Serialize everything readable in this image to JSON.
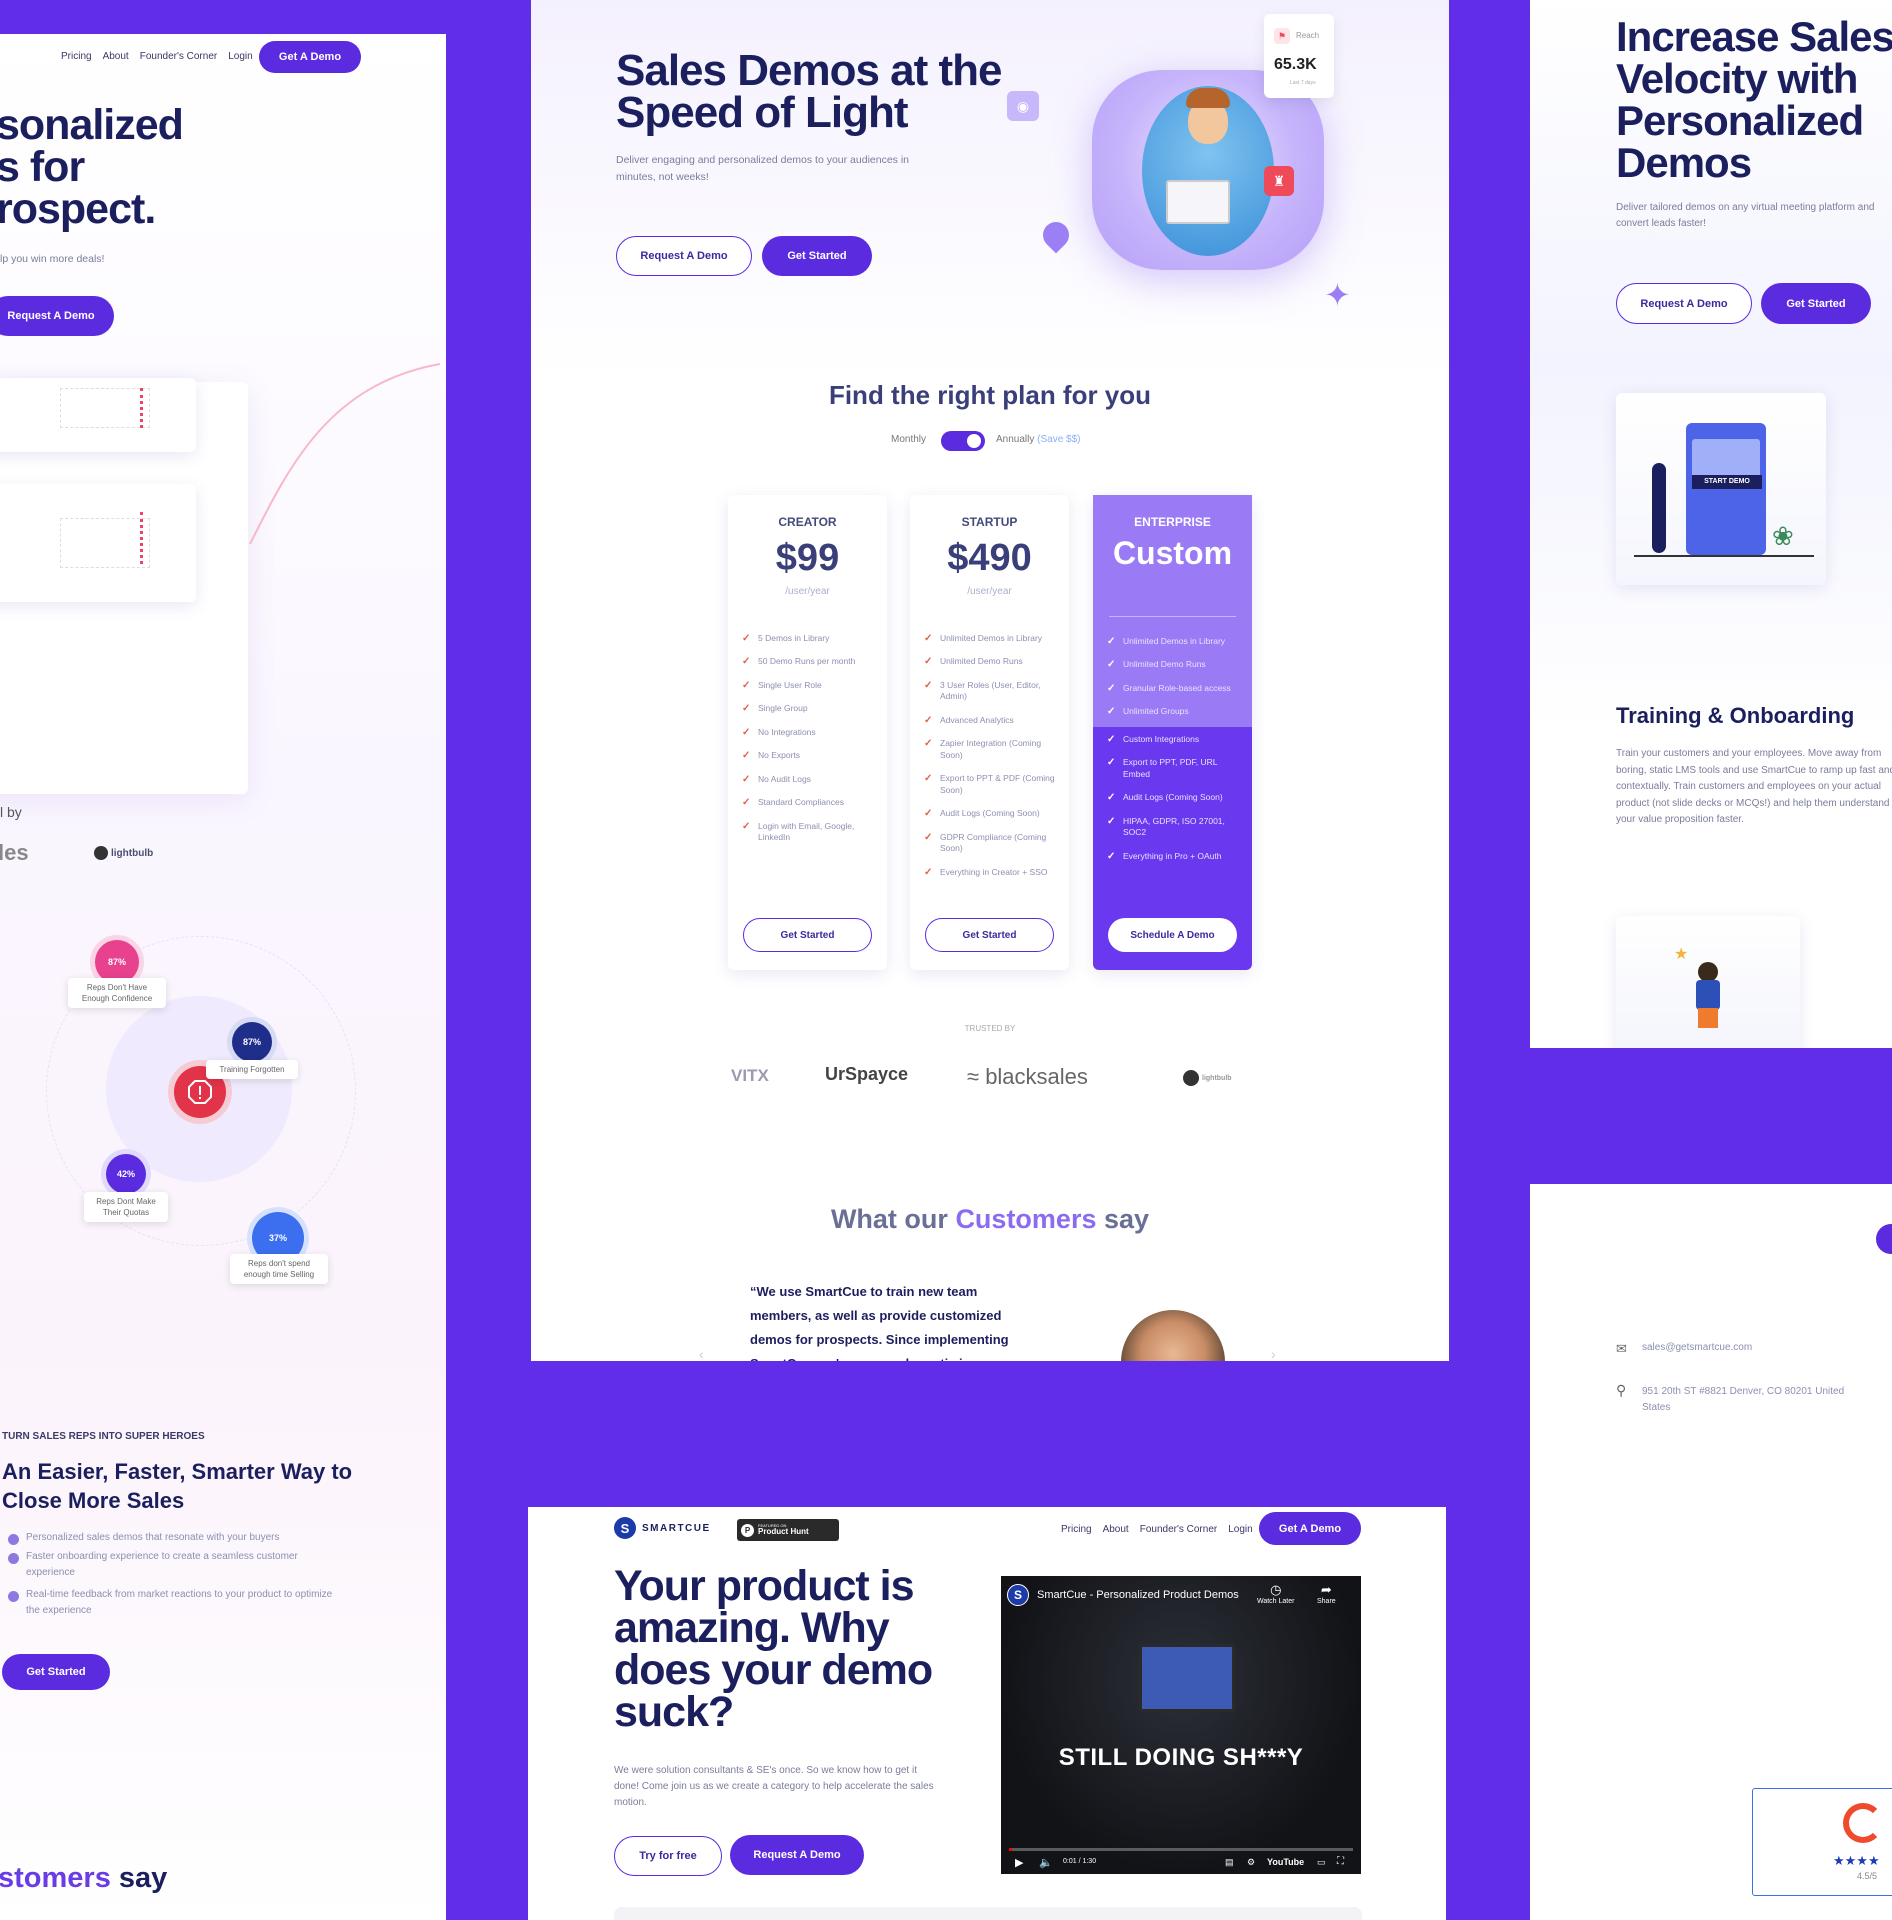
{
  "colors": {
    "brand": "#5b2be0",
    "background": "#612de8",
    "accent": "#8b6cf0",
    "check": "#e0614a",
    "pink": "#e8418e",
    "navy": "#1c1f5e"
  },
  "left": {
    "nav": [
      "Pricing",
      "About",
      "Founder's Corner",
      "Login"
    ],
    "nav_cta": "Get A Demo",
    "hero_lines": [
      "sonalized",
      "s for",
      "rospect."
    ],
    "hero_sub": "lp you win more deals!",
    "hero_cta": "Request A Demo",
    "trusted_label": "l by",
    "logos": [
      "les",
      "lightbulb"
    ],
    "stats": [
      {
        "value": "87%",
        "label": "Reps Don't Have Enough Confidence",
        "color": "#e8418e"
      },
      {
        "value": "87%",
        "label": "Training Forgotten",
        "color": "#1e2e8a"
      },
      {
        "value": "42%",
        "label": "Reps Dont Make Their Quotas",
        "color": "#5b2be0"
      },
      {
        "value": "37%",
        "label": "Reps don't spend enough time Selling",
        "color": "#3b6ff0"
      }
    ],
    "center_icon": "alert-icon",
    "eyebrow": "TURN SALES REPS INTO SUPER HEROES",
    "section_title": "An Easier, Faster, Smarter Way to Close More Sales",
    "bullets": [
      "Personalized sales demos that resonate with your buyers",
      "Faster onboarding experience to create a seamless customer experience",
      "Real-time feedback from market reactions to your product to optimize the experience"
    ],
    "cta": "Get Started",
    "bottom_title_a": "stomers",
    "bottom_title_b": "say"
  },
  "center": {
    "hero_title": "Sales Demos at the Speed of Light",
    "hero_sub": "Deliver engaging and personalized demos to your audiences in minutes, not weeks!",
    "btn_demo": "Request A Demo",
    "btn_start": "Get Started",
    "reach_label": "Reach",
    "reach_value": "65.3K",
    "reach_period": "Last 7 days",
    "pricing_title": "Find the right plan for you",
    "toggle_monthly": "Monthly",
    "toggle_annually": "Annually",
    "toggle_save": "(Save $$)",
    "plans": [
      {
        "name": "CREATOR",
        "price": "$99",
        "per": "/user/year",
        "cta": "Get Started",
        "features": [
          "5 Demos in Library",
          "50 Demo Runs per month",
          "Single User Role",
          "Single Group",
          "No Integrations",
          "No Exports",
          "No Audit Logs",
          "Standard Compliances",
          "Login with Email, Google, LinkedIn"
        ]
      },
      {
        "name": "STARTUP",
        "price": "$490",
        "per": "/user/year",
        "cta": "Get Started",
        "features": [
          "Unlimited Demos in Library",
          "Unlimited Demo Runs",
          "3 User Roles (User, Editor, Admin)",
          "Advanced Analytics",
          "Zapier Integration (Coming Soon)",
          "Export to PPT & PDF (Coming Soon)",
          "Audit Logs (Coming Soon)",
          "GDPR Compliance (Coming Soon)",
          "Everything in Creator + SSO"
        ]
      },
      {
        "name": "ENTERPRISE",
        "price": "Custom",
        "per": "",
        "cta": "Schedule A Demo",
        "features": [
          "Unlimited Demos in Library",
          "Unlimited Demo Runs",
          "Granular Role-based access",
          "Unlimited Groups",
          "Custom Integrations",
          "Export to PPT, PDF, URL Embed",
          "Audit Logs (Coming Soon)",
          "HIPAA, GDPR, ISO 27001, SOC2",
          "Everything in Pro + OAuth"
        ]
      }
    ],
    "trusted_by": "TRUSTED BY",
    "logos": [
      "VITX",
      "UrSpayce",
      "blacksales",
      "lightbulb"
    ],
    "testimonial_title_a": "What our",
    "testimonial_title_b": "Customers",
    "testimonial_title_c": "say",
    "quote": "“We use SmartCue to train new team members, as well as provide customized demos for prospects. Since implementing SmartCue, we've seen a dramatic increase in"
  },
  "bottom": {
    "brand": "SMARTCUE",
    "ph_small": "FEATURED ON",
    "ph_label": "Product Hunt",
    "nav": [
      "Pricing",
      "About",
      "Founder's Corner",
      "Login"
    ],
    "nav_cta": "Get A Demo",
    "title": "Your product is amazing. Why does your demo suck?",
    "sub": "We were solution consultants & SE's once. So we know how to get it done! Come join us as we create a category to help accelerate the sales motion.",
    "btn_try": "Try for free",
    "btn_demo": "Request A Demo",
    "video_title": "SmartCue - Personalized Product Demos",
    "watch_later": "Watch Later",
    "share": "Share",
    "video_caption": "STILL DOING SH***Y",
    "video_time": "0:01 / 1:30",
    "youtube": "YouTube",
    "video_progress": 0.01
  },
  "right": {
    "title": "Increase Sales Velocity with Personalized Demos",
    "sub": "Deliver tailored demos on any virtual meeting platform and convert leads faster!",
    "btn_demo": "Request A Demo",
    "btn_start": "Get Started",
    "start_demo": "START DEMO",
    "section_title": "Training & Onboarding",
    "section_body": "Train your customers and your employees. Move away from boring, static LMS tools and use SmartCue to ramp up fast and contextually. Train customers and employees on your actual product (not slide decks or MCQs!) and help them understand your value proposition faster.",
    "email": "sales@getsmartcue.com",
    "address": "951 20th ST #8821 Denver, CO 80201 United States",
    "g2_rating": "4.5/5",
    "g2_stars": "★★★★"
  }
}
